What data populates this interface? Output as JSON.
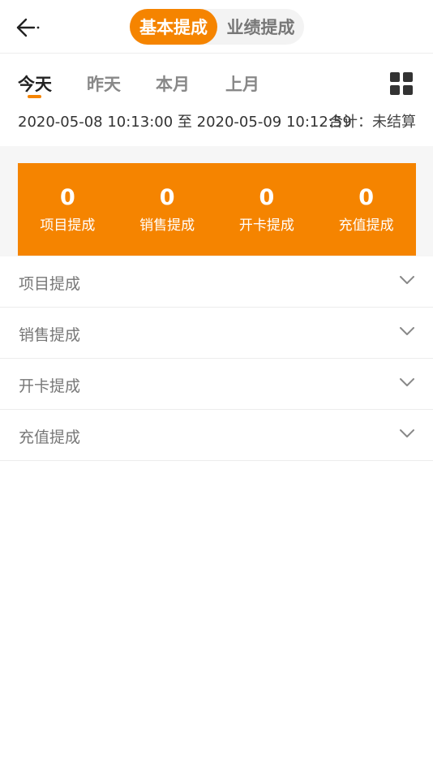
{
  "header": {
    "back_icon": "arrow-left-icon",
    "segments": [
      {
        "label": "基本提成",
        "active": true
      },
      {
        "label": "业绩提成",
        "active": false
      }
    ]
  },
  "tabs": [
    {
      "label": "今天",
      "active": true
    },
    {
      "label": "昨天",
      "active": false
    },
    {
      "label": "本月",
      "active": false
    },
    {
      "label": "上月",
      "active": false
    }
  ],
  "grid_icon": "grid-icon",
  "date_range": "2020-05-08 10:13:00 至 2020-05-09 10:12:59",
  "total": {
    "label": "合计：",
    "value": "未结算"
  },
  "summary": [
    {
      "value": "0",
      "label": "项目提成"
    },
    {
      "value": "0",
      "label": "销售提成"
    },
    {
      "value": "0",
      "label": "开卡提成"
    },
    {
      "value": "0",
      "label": "充值提成"
    }
  ],
  "sections": [
    {
      "label": "项目提成",
      "icon": "chevron-down-icon"
    },
    {
      "label": "销售提成",
      "icon": "chevron-down-icon"
    },
    {
      "label": "开卡提成",
      "icon": "chevron-down-icon"
    },
    {
      "label": "充值提成",
      "icon": "chevron-down-icon"
    }
  ],
  "colors": {
    "accent": "#f58400",
    "background": "#ffffff",
    "band": "#f6f6f6"
  }
}
